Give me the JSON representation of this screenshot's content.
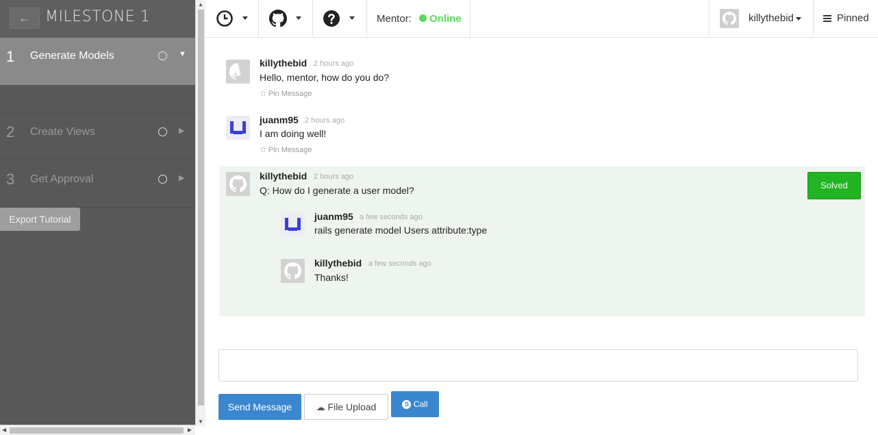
{
  "sidebar": {
    "back_label": "←",
    "title": "MILESTONE 1",
    "steps": [
      {
        "number": "1",
        "label": "Generate Models",
        "active": true
      },
      {
        "number": "2",
        "label": "Create Views",
        "active": false
      },
      {
        "number": "3",
        "label": "Get Approval",
        "active": false
      }
    ],
    "export_label": "Export Tutorial"
  },
  "topbar": {
    "icons": [
      "clock-icon",
      "github-icon",
      "help-icon"
    ],
    "mentor_label": "Mentor:",
    "mentor_status": "Online",
    "status_color": "#5cd65c",
    "username": "killythebid",
    "pinned_label": "Pinned"
  },
  "messages": [
    {
      "author": "killythebid",
      "time": "2 hours ago",
      "text": "Hello, mentor, how do you do?",
      "pin": "Pin Message"
    },
    {
      "author": "juanm95",
      "time": "2 hours ago",
      "text": "I am doing well!",
      "pin": "Pin Message"
    },
    {
      "author": "killythebid",
      "time": "2 hours ago",
      "text": "Q: How do I generate a user model?",
      "solved_label": "Solved",
      "replies": [
        {
          "author": "juanm95",
          "time": "a few seconds ago",
          "text": "rails generate model Users attribute:type"
        },
        {
          "author": "killythebid",
          "time": "a few seconds ago",
          "text": "Thanks!"
        }
      ]
    }
  ],
  "compose": {
    "value": "",
    "send_label": "Send Message",
    "upload_label": "File Upload",
    "call_label": "Call"
  },
  "colors": {
    "accent": "#3a87d0",
    "solved": "#22b422",
    "question_bg": "#eef5ee",
    "sidebar_bg": "#585858"
  }
}
